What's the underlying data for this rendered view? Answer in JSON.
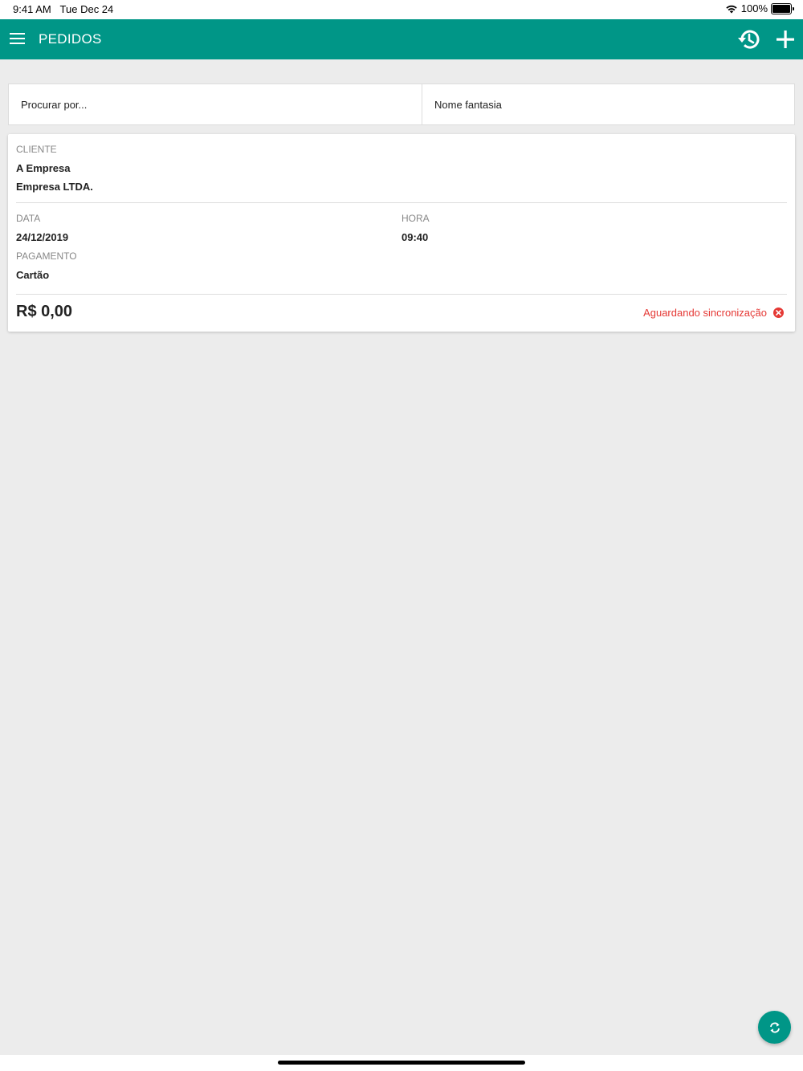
{
  "status_bar": {
    "time": "9:41 AM",
    "date": "Tue Dec 24",
    "battery": "100%"
  },
  "app_bar": {
    "title": "PEDIDOS",
    "menu_icon": "hamburger-menu-icon",
    "history_icon": "history-icon",
    "add_icon": "plus-icon",
    "color": "#009687"
  },
  "search": {
    "placeholder": "Procurar por...",
    "value": "",
    "filter_selected": "Nome fantasia"
  },
  "order": {
    "client_label": "CLIENTE",
    "client_name": "A Empresa",
    "client_company": "Empresa LTDA.",
    "date_label": "DATA",
    "date_value": "24/12/2019",
    "time_label": "HORA",
    "time_value": "09:40",
    "payment_label": "PAGAMENTO",
    "payment_value": "Cartão",
    "total": "R$ 0,00",
    "sync_status": "Aguardando sincronização",
    "sync_status_color": "#e53935",
    "sync_icon": "error-circle-icon"
  },
  "fab": {
    "icon": "sync-icon"
  }
}
